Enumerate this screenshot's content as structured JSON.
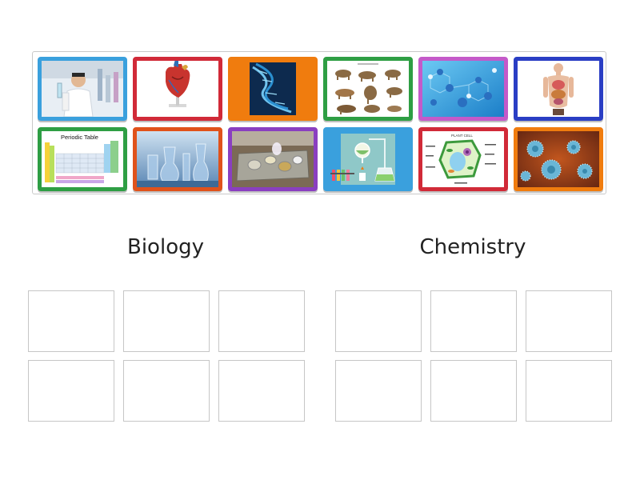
{
  "tiles": [
    {
      "name": "scientist-lab-image",
      "border": "#3aa0dd"
    },
    {
      "name": "heart-model-image",
      "border": "#d12a38"
    },
    {
      "name": "dna-helix-image",
      "border": "#f07c0e"
    },
    {
      "name": "animals-evolution-image",
      "border": "#2e9e44"
    },
    {
      "name": "molecules-image",
      "border": "#c45ac9"
    },
    {
      "name": "human-torso-image",
      "border": "#2a3ec4"
    },
    {
      "name": "periodic-table-image",
      "border": "#2e9e44",
      "caption": "Periodic Table"
    },
    {
      "name": "lab-glassware-image",
      "border": "#e0521b"
    },
    {
      "name": "chemical-tray-image",
      "border": "#8a3fc0"
    },
    {
      "name": "distillation-illustration-image",
      "border": "#3aa0dd"
    },
    {
      "name": "plant-cell-diagram-image",
      "border": "#d12a38",
      "caption": "PLANT CELL"
    },
    {
      "name": "virus-particles-image",
      "border": "#f07c0e"
    }
  ],
  "groups": {
    "biology": {
      "title": "Biology"
    },
    "chemistry": {
      "title": "Chemistry"
    }
  }
}
